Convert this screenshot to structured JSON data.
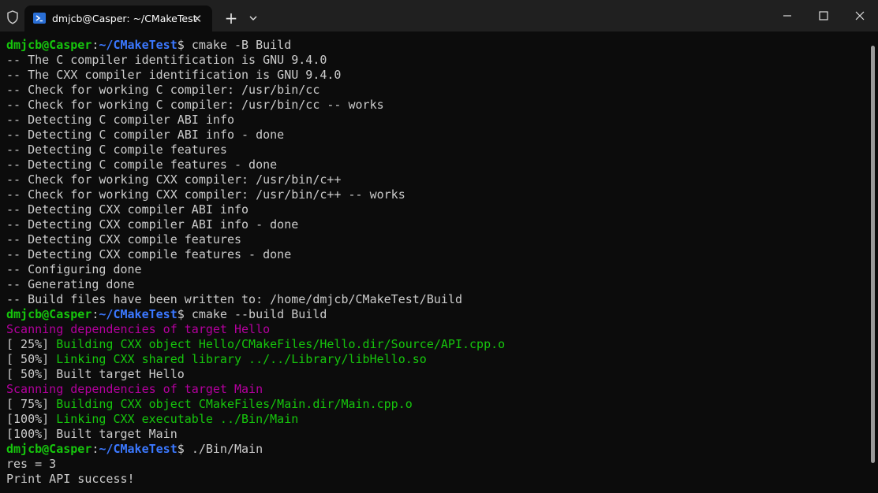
{
  "window": {
    "tab_title": "dmjcb@Casper: ~/CMakeTest",
    "tab_close_glyph": "✕",
    "new_tab_glyph": "+"
  },
  "prompt": {
    "user_host": "dmjcb@Casper",
    "colon": ":",
    "path": "~/CMakeTest",
    "symbol": "$ "
  },
  "lines": [
    {
      "type": "prompt",
      "command": "cmake -B Build"
    },
    {
      "type": "plain",
      "text": "-- The C compiler identification is GNU 9.4.0"
    },
    {
      "type": "plain",
      "text": "-- The CXX compiler identification is GNU 9.4.0"
    },
    {
      "type": "plain",
      "text": "-- Check for working C compiler: /usr/bin/cc"
    },
    {
      "type": "plain",
      "text": "-- Check for working C compiler: /usr/bin/cc -- works"
    },
    {
      "type": "plain",
      "text": "-- Detecting C compiler ABI info"
    },
    {
      "type": "plain",
      "text": "-- Detecting C compiler ABI info - done"
    },
    {
      "type": "plain",
      "text": "-- Detecting C compile features"
    },
    {
      "type": "plain",
      "text": "-- Detecting C compile features - done"
    },
    {
      "type": "plain",
      "text": "-- Check for working CXX compiler: /usr/bin/c++"
    },
    {
      "type": "plain",
      "text": "-- Check for working CXX compiler: /usr/bin/c++ -- works"
    },
    {
      "type": "plain",
      "text": "-- Detecting CXX compiler ABI info"
    },
    {
      "type": "plain",
      "text": "-- Detecting CXX compiler ABI info - done"
    },
    {
      "type": "plain",
      "text": "-- Detecting CXX compile features"
    },
    {
      "type": "plain",
      "text": "-- Detecting CXX compile features - done"
    },
    {
      "type": "plain",
      "text": "-- Configuring done"
    },
    {
      "type": "plain",
      "text": "-- Generating done"
    },
    {
      "type": "plain",
      "text": "-- Build files have been written to: /home/dmjcb/CMakeTest/Build"
    },
    {
      "type": "prompt",
      "command": "cmake --build Build"
    },
    {
      "type": "magenta",
      "text": "Scanning dependencies of target Hello"
    },
    {
      "type": "progress",
      "prefix": "[ 25%] ",
      "text": "Building CXX object Hello/CMakeFiles/Hello.dir/Source/API.cpp.o",
      "color": "green"
    },
    {
      "type": "progress",
      "prefix": "[ 50%] ",
      "text": "Linking CXX shared library ../../Library/libHello.so",
      "color": "green"
    },
    {
      "type": "progress",
      "prefix": "[ 50%] ",
      "text": "Built target Hello",
      "color": "white"
    },
    {
      "type": "magenta",
      "text": "Scanning dependencies of target Main"
    },
    {
      "type": "progress",
      "prefix": "[ 75%] ",
      "text": "Building CXX object CMakeFiles/Main.dir/Main.cpp.o",
      "color": "green"
    },
    {
      "type": "progress",
      "prefix": "[100%] ",
      "text": "Linking CXX executable ../Bin/Main",
      "color": "green"
    },
    {
      "type": "progress",
      "prefix": "[100%] ",
      "text": "Built target Main",
      "color": "white"
    },
    {
      "type": "prompt",
      "command": "./Bin/Main"
    },
    {
      "type": "plain",
      "text": "res = 3"
    },
    {
      "type": "plain",
      "text": "Print API success!"
    }
  ],
  "colors": {
    "background": "#0c0c0c",
    "titlebar": "#202020",
    "user": "#16c60c",
    "path": "#3b78ff",
    "magenta": "#b4009e",
    "green": "#16c60c",
    "text": "#cccccc"
  },
  "icons": {
    "shield": "shield-icon",
    "tab": "powershell-icon",
    "close_tab": "close-icon",
    "new_tab": "plus-icon",
    "dropdown": "chevron-down-icon",
    "minimize": "minimize-icon",
    "maximize": "maximize-icon",
    "close_window": "close-icon"
  }
}
